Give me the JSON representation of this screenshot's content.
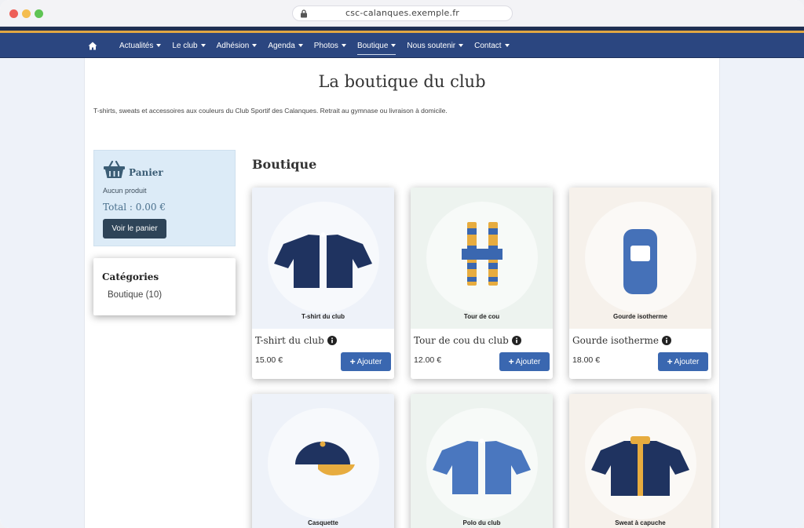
{
  "browser": {
    "url": "csc-calanques.exemple.fr"
  },
  "nav": {
    "items": [
      {
        "label": "Actualités"
      },
      {
        "label": "Le club"
      },
      {
        "label": "Adhésion"
      },
      {
        "label": "Agenda"
      },
      {
        "label": "Photos"
      },
      {
        "label": "Boutique"
      },
      {
        "label": "Nous soutenir"
      },
      {
        "label": "Contact"
      }
    ],
    "active": "Boutique"
  },
  "page": {
    "title": "La boutique du club",
    "intro": "T-shirts, sweats et accessoires aux couleurs du Club Sportif des Calanques. Retrait au gymnase ou livraison à domicile.",
    "section_title": "Boutique"
  },
  "cart": {
    "title": "Panier",
    "empty_text": "Aucun produit",
    "total": "Total : 0.00 €",
    "button_label": "Voir le panier"
  },
  "categories": {
    "title": "Catégories",
    "items": [
      {
        "label": "Boutique (10)"
      }
    ]
  },
  "products": [
    {
      "caption": "T-shirt du club",
      "name": "T-shirt du club",
      "price": "15.00 €",
      "add_label": "Ajouter",
      "icon": "tshirt-icon",
      "bg": "#eef2f9"
    },
    {
      "caption": "Tour de cou",
      "name": "Tour de cou du club",
      "price": "12.00 €",
      "add_label": "Ajouter",
      "icon": "neck-warmer-icon",
      "bg": "#edf3ef"
    },
    {
      "caption": "Gourde isotherme",
      "name": "Gourde isotherme",
      "price": "18.00 €",
      "add_label": "Ajouter",
      "icon": "water-bottle-icon",
      "bg": "#f6f1eb"
    },
    {
      "caption": "Casquette",
      "icon": "cap-icon",
      "bg": "#eef2f9"
    },
    {
      "caption": "Polo du club",
      "icon": "polo-icon",
      "bg": "#edf3ef"
    },
    {
      "caption": "Sweat à capuche",
      "icon": "hoodie-icon",
      "bg": "#f6f1eb"
    }
  ],
  "colors": {
    "navy": "#1f3360",
    "nav_bg": "#2b4680",
    "gold": "#e0a642",
    "blue": "#3a67b0",
    "cart_bg": "#dcebf7"
  }
}
